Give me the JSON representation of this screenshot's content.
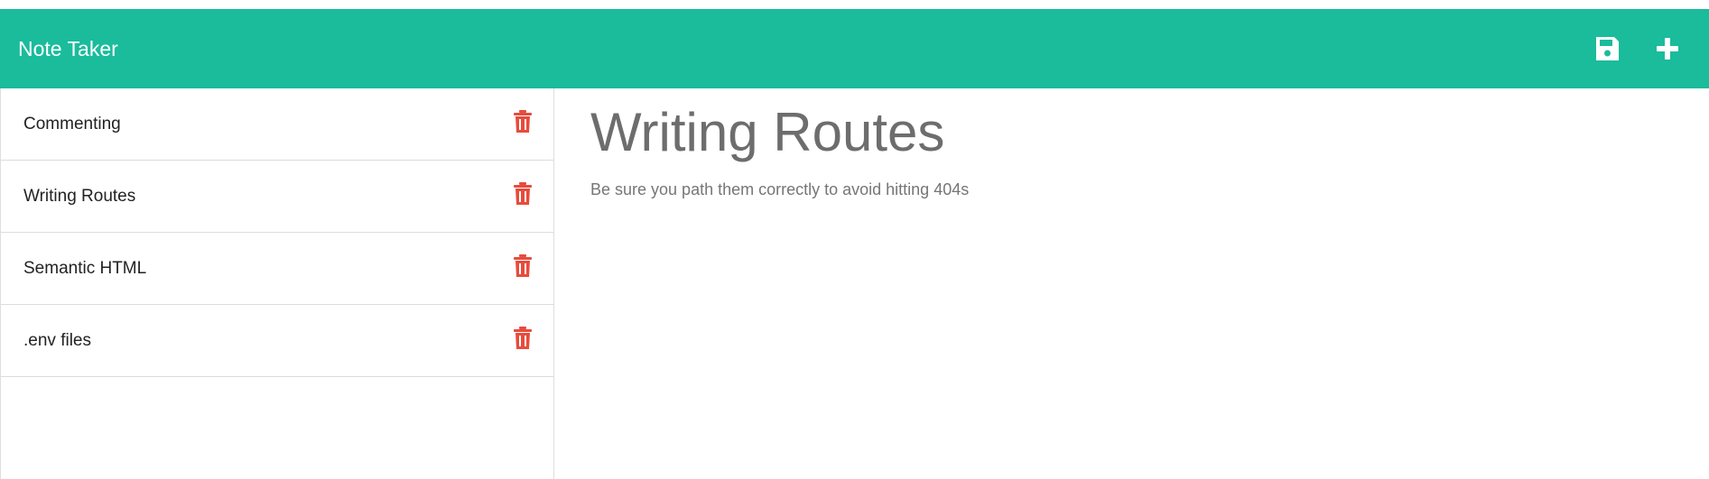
{
  "app": {
    "title": "Note Taker",
    "accent_color": "#1abc9c",
    "delete_color": "#e74c3c"
  },
  "toolbar": {
    "save_icon": "save-icon",
    "add_icon": "plus-icon"
  },
  "notes": [
    {
      "title": "Commenting"
    },
    {
      "title": "Writing Routes"
    },
    {
      "title": "Semantic HTML"
    },
    {
      "title": ".env files"
    }
  ],
  "active_note": {
    "title": "Writing Routes",
    "text": "Be sure you path them correctly to avoid hitting 404s"
  }
}
